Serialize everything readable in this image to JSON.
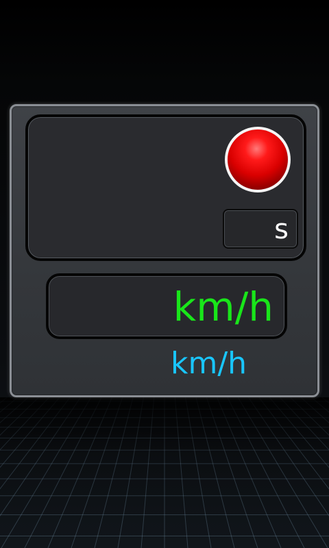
{
  "recorder": {
    "record_button_icon": "record-dot-icon",
    "record_color": "#e00000"
  },
  "timer": {
    "unit": "s"
  },
  "speed": {
    "unit": "km/h",
    "color": "#19e61a"
  },
  "average_speed": {
    "unit": "km/h",
    "color": "#19c6ff"
  }
}
